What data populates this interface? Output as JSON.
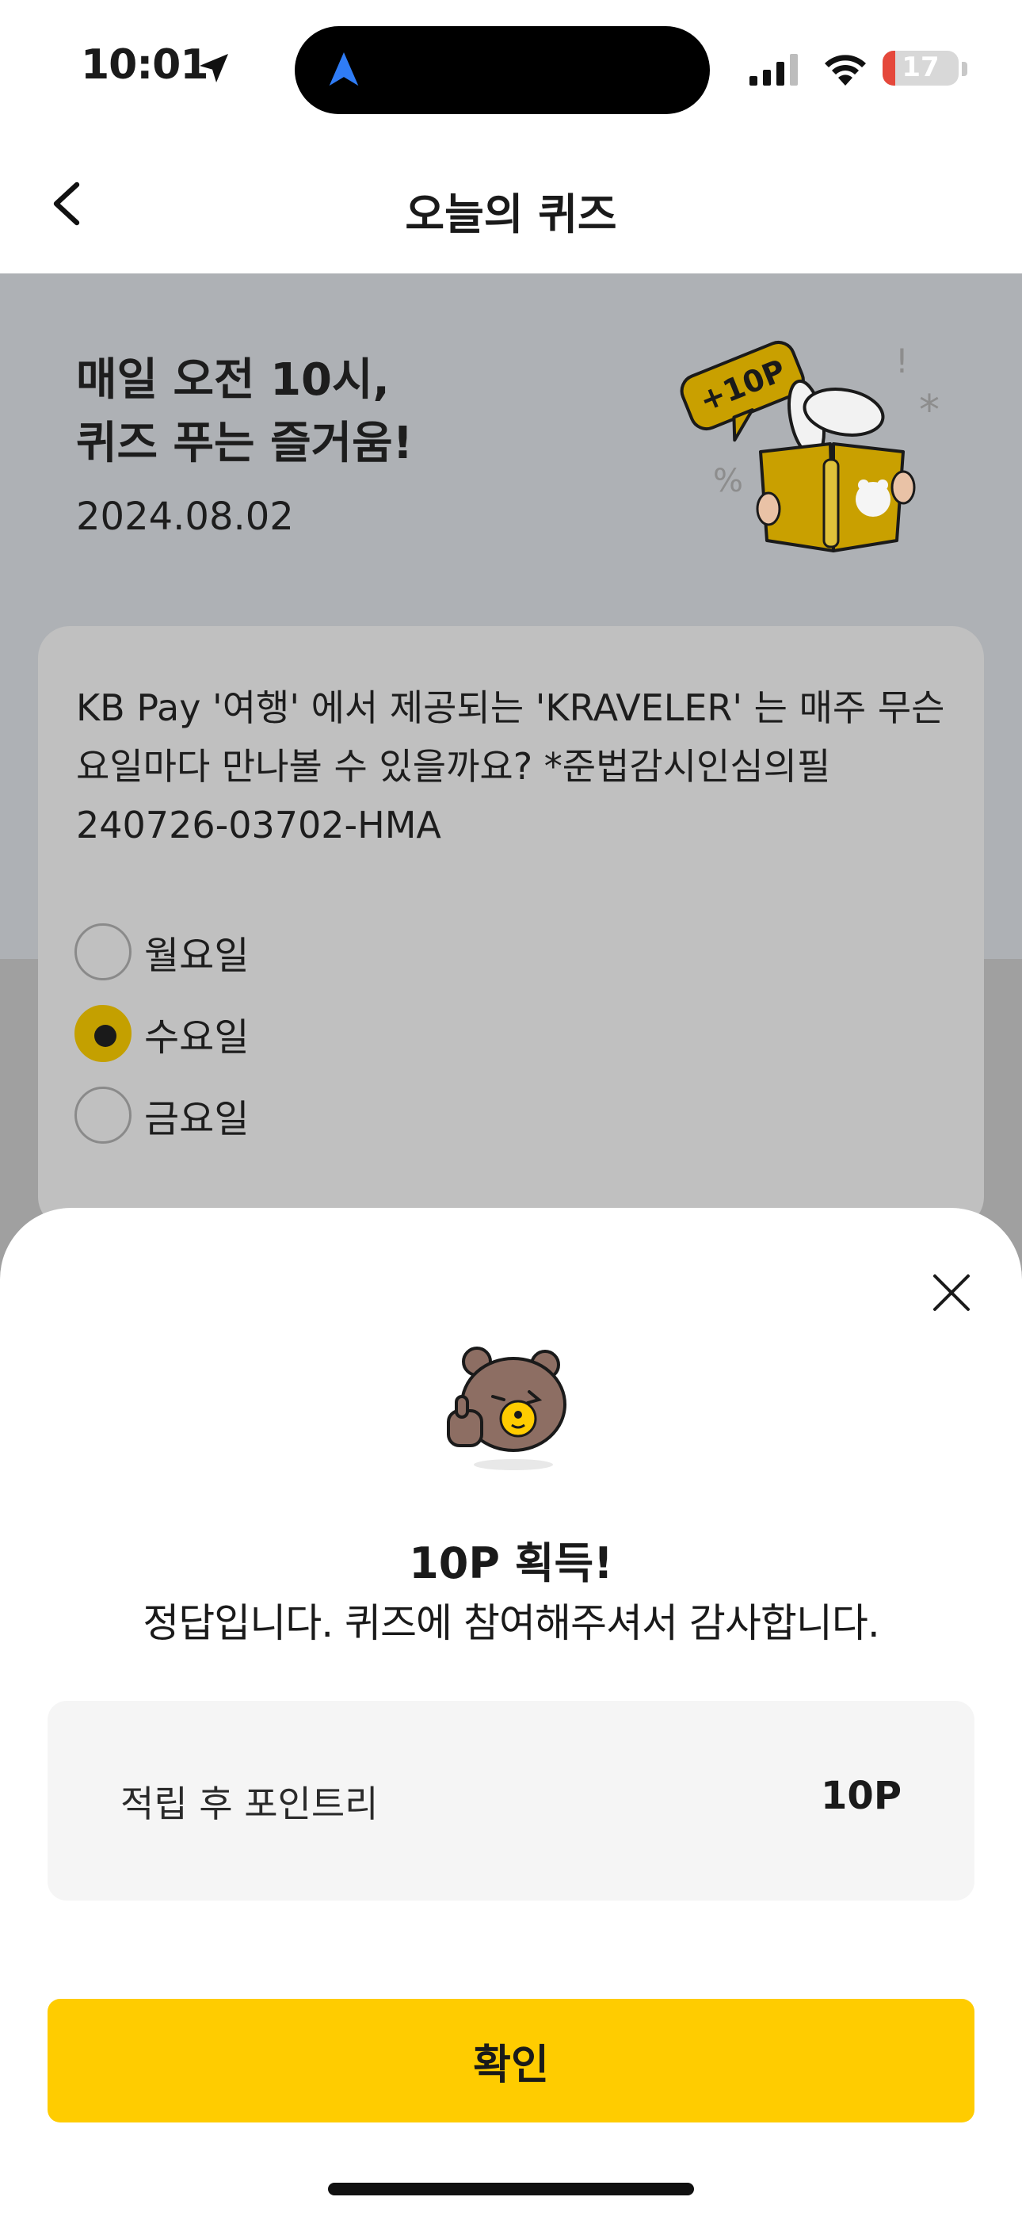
{
  "status_bar": {
    "time": "10:01",
    "battery_level": "17",
    "battery_fraction": 0.17,
    "battery_color": "#e5483b",
    "icons": [
      "location-arrow-icon",
      "navigation-icon",
      "signal-icon",
      "wifi-icon",
      "battery-icon"
    ]
  },
  "nav": {
    "title": "오늘의 퀴즈",
    "back_icon": "chevron-left-icon"
  },
  "hero": {
    "title_line1": "매일 오전 10시,",
    "title_line2": "퀴즈 푸는 즐거움!",
    "date": "2024.08.02",
    "badge": "+10P"
  },
  "quiz": {
    "question": "KB Pay '여행' 에서 제공되는 'KRAVELER' 는 매주 무슨 요일마다 만나볼 수 있을까요? *준법감시인심의필240726-03702-HMA",
    "options": [
      {
        "label": "월요일",
        "selected": false
      },
      {
        "label": "수요일",
        "selected": true
      },
      {
        "label": "금요일",
        "selected": false
      }
    ]
  },
  "sheet": {
    "title": "10P 획득!",
    "message": "정답입니다. 퀴즈에 참여해주셔서 감사합니다.",
    "points_label": "적립 후 포인트리",
    "points_value": "10P",
    "confirm_label": "확인",
    "close_icon": "close-icon"
  },
  "colors": {
    "accent": "#ffcc00",
    "radio_selected": "#c4a000",
    "dim_overlay": "#a0a0a0"
  }
}
